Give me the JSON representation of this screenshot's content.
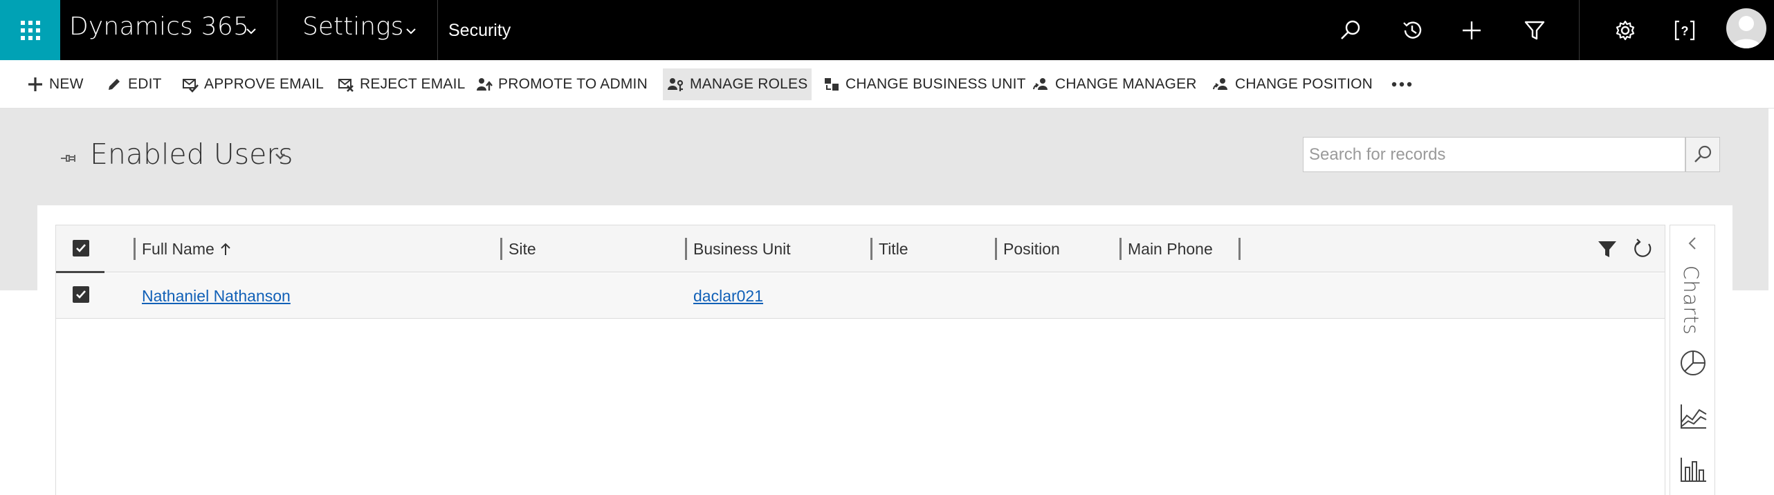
{
  "nav": {
    "app_name": "Dynamics 365",
    "area_name": "Settings",
    "breadcrumb": "Security",
    "icons": [
      "search-icon",
      "recent-icon",
      "new-record-icon",
      "advanced-find-icon",
      "gear-icon",
      "help-icon",
      "user-avatar"
    ]
  },
  "commands": {
    "new": "NEW",
    "edit": "EDIT",
    "approve_email": "APPROVE EMAIL",
    "reject_email": "REJECT EMAIL",
    "promote_to_admin": "PROMOTE TO ADMIN",
    "manage_roles": "MANAGE ROLES",
    "change_business_unit": "CHANGE BUSINESS UNIT",
    "change_manager": "CHANGE MANAGER",
    "change_position": "CHANGE POSITION"
  },
  "view": {
    "title": "Enabled Users",
    "search_placeholder": "Search for records"
  },
  "grid": {
    "columns": {
      "full_name": "Full Name",
      "site": "Site",
      "business_unit": "Business Unit",
      "title": "Title",
      "position": "Position",
      "main_phone": "Main Phone"
    },
    "sort": {
      "column": "Full Name",
      "direction": "ascending"
    },
    "rows": [
      {
        "full_name": "Nathaniel Nathanson",
        "site": "",
        "business_unit": "daclar021",
        "title": "",
        "position": "",
        "main_phone": "",
        "selected": true
      }
    ]
  },
  "charts_pane": {
    "label": "Charts"
  },
  "colors": {
    "nav_bg": "#000000",
    "waffle_bg": "#00a2b5",
    "header_band": "#e6e6e6",
    "link": "#1160b7",
    "active_command": "#e6e6e6"
  }
}
